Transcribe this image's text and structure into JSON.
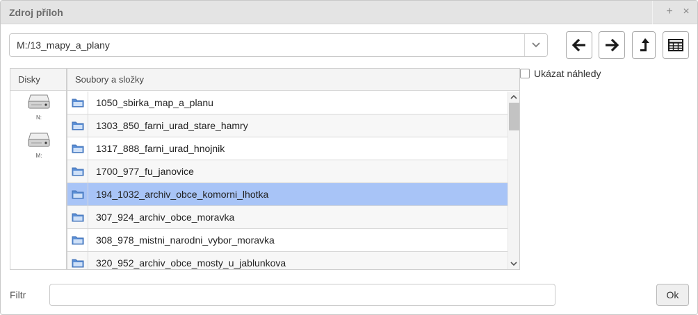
{
  "dialog": {
    "title": "Zdroj příloh",
    "add_glyph": "+",
    "close_glyph": "×"
  },
  "path": {
    "value": "M:/13_mapy_a_plany"
  },
  "nav": {
    "back_icon": "arrow-left-icon",
    "forward_icon": "arrow-right-icon",
    "up_icon": "folder-up-icon",
    "view_icon": "table-view-icon"
  },
  "disks": {
    "header": "Disky",
    "items": [
      {
        "label": "N:",
        "icon": "hard-drive-icon"
      },
      {
        "label": "M:",
        "icon": "hard-drive-icon"
      }
    ]
  },
  "files": {
    "header": "Soubory a složky",
    "rows": [
      {
        "name": "1050_sbirka_map_a_planu",
        "icon": "folder-icon"
      },
      {
        "name": "1303_850_farni_urad_stare_hamry",
        "icon": "folder-icon"
      },
      {
        "name": "1317_888_farni_urad_hnojnik",
        "icon": "folder-icon"
      },
      {
        "name": "1700_977_fu_janovice",
        "icon": "folder-icon"
      },
      {
        "name": "194_1032_archiv_obce_komorni_lhotka",
        "icon": "folder-icon",
        "selected": true
      },
      {
        "name": "307_924_archiv_obce_moravka",
        "icon": "folder-icon"
      },
      {
        "name": "308_978_mistni_narodni_vybor_moravka",
        "icon": "folder-icon"
      },
      {
        "name": "320_952_archiv_obce_mosty_u_jablunkova",
        "icon": "folder-icon"
      }
    ]
  },
  "preview": {
    "label": "Ukázat náhledy",
    "checked": false
  },
  "filter": {
    "label": "Filtr",
    "value": ""
  },
  "ok": {
    "label": "Ok"
  },
  "colors": {
    "selected_row": "#a8c4f7",
    "folder": "#5b8fd6"
  }
}
